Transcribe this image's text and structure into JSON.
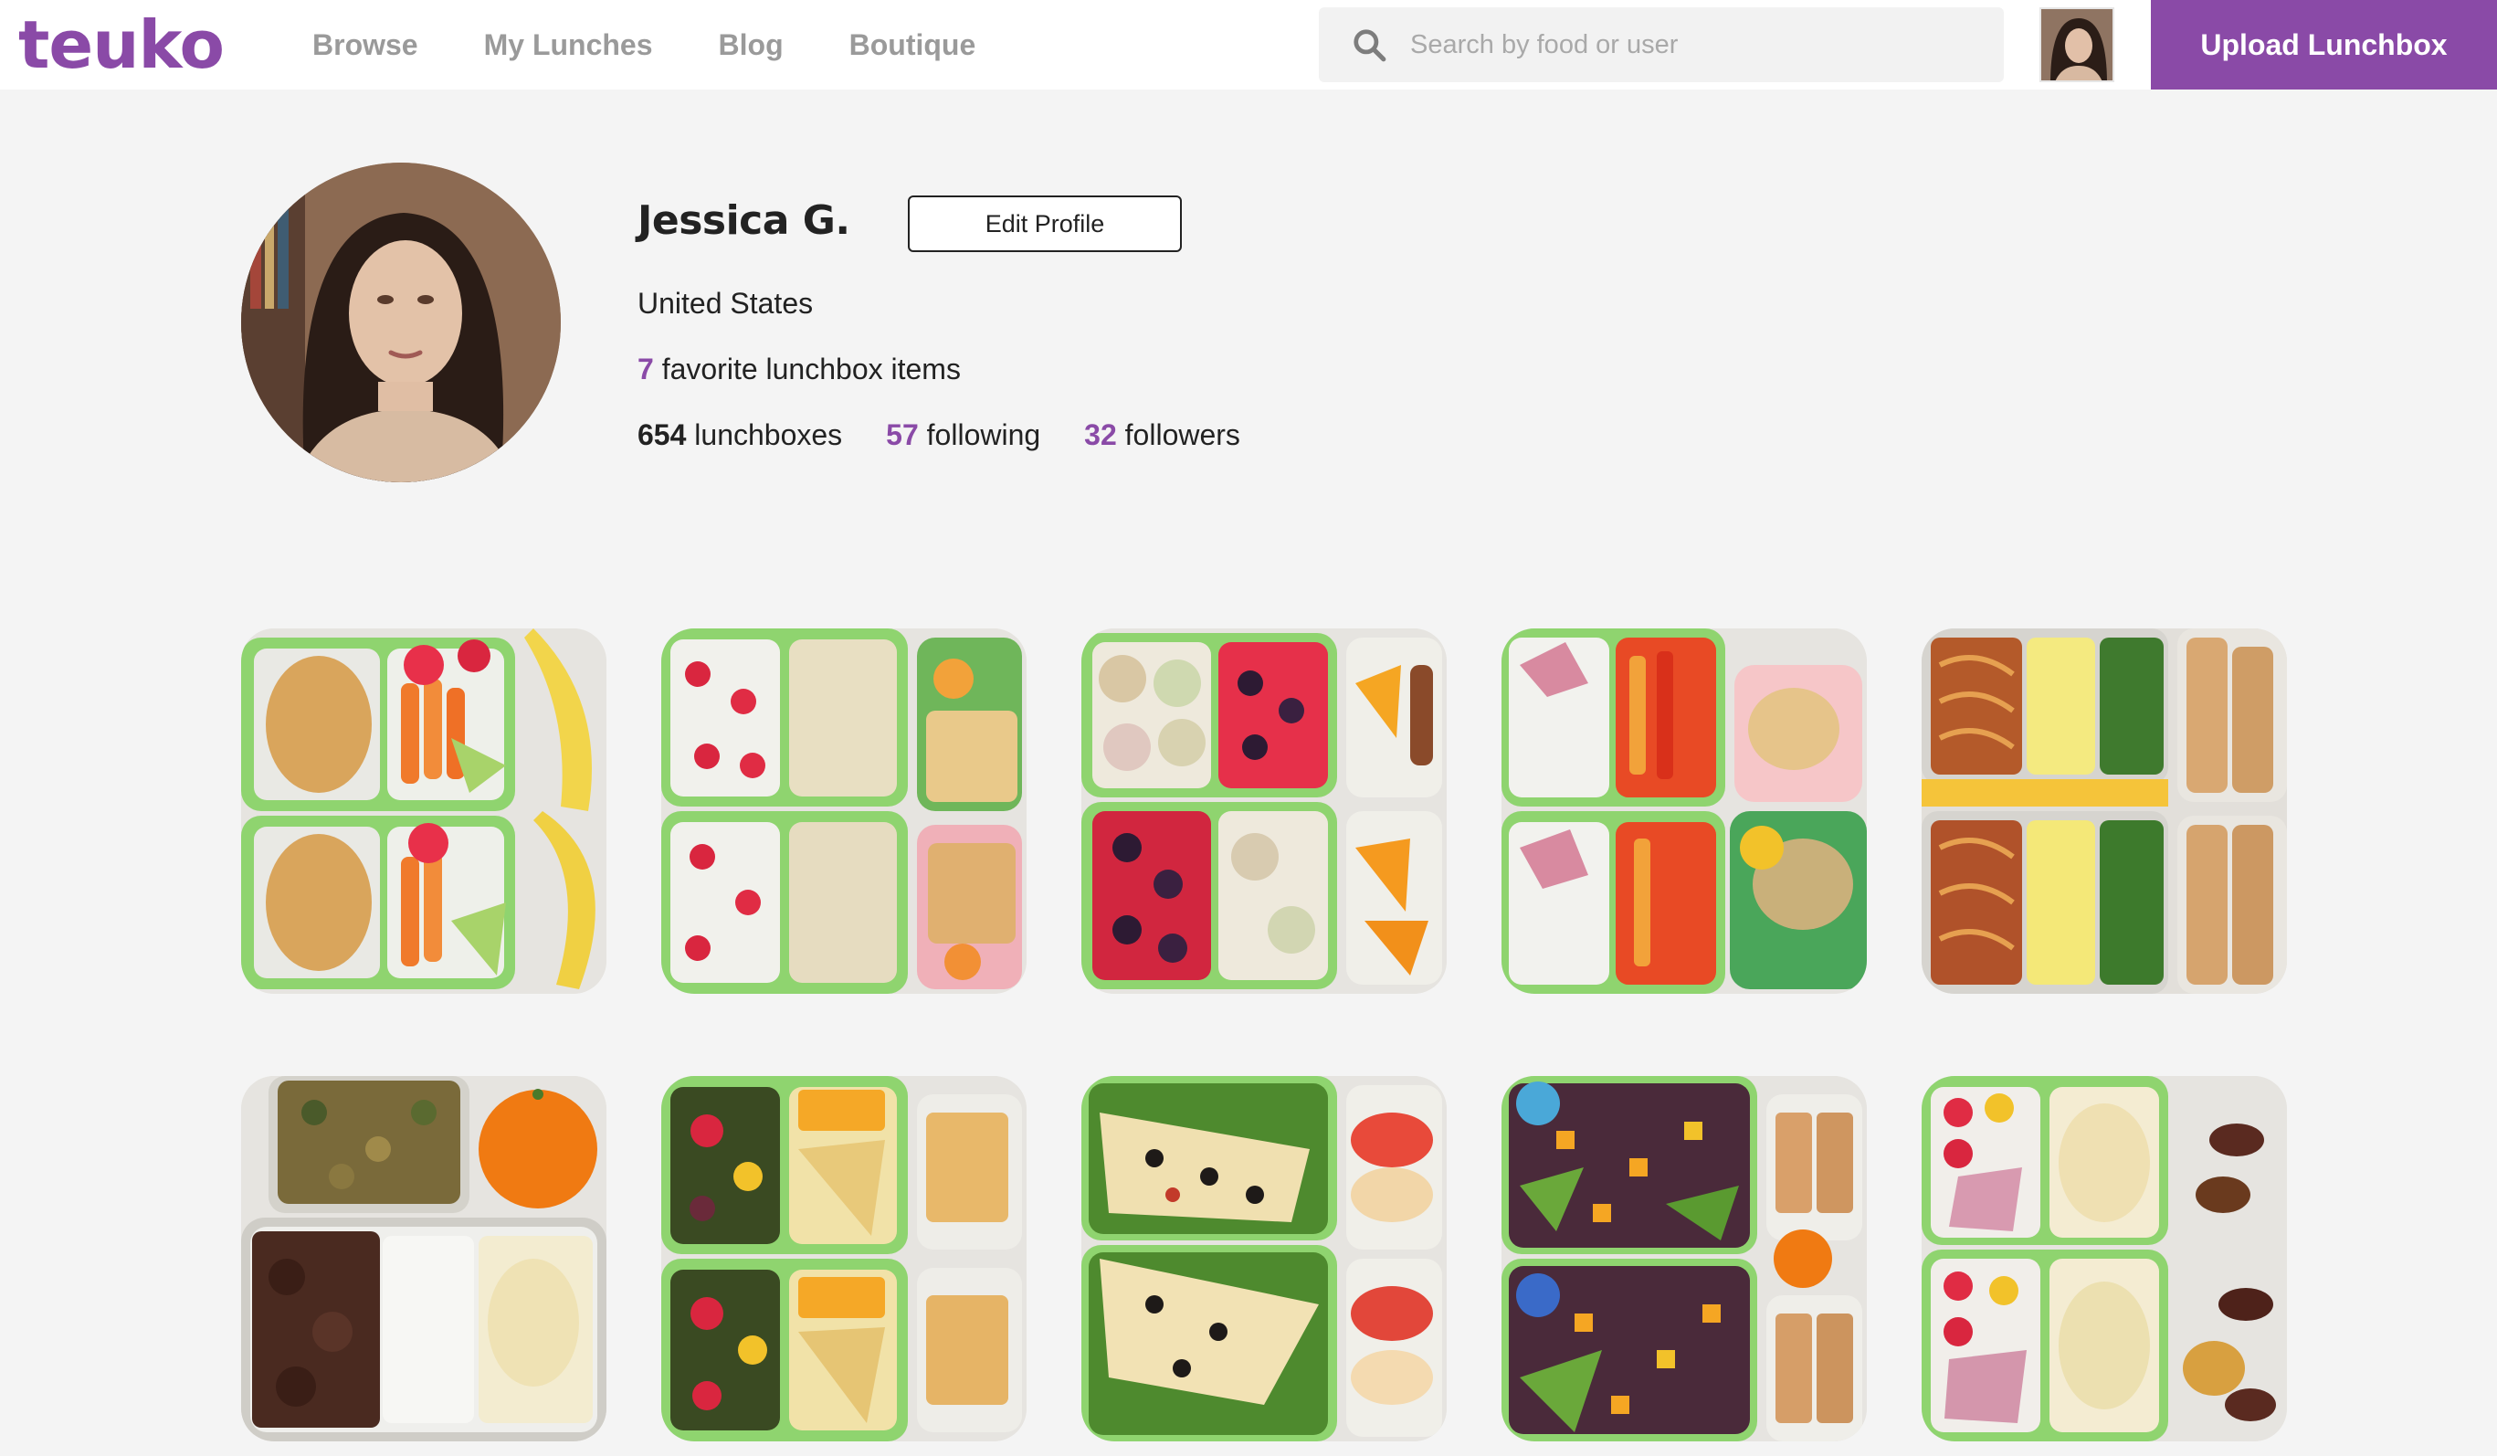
{
  "header": {
    "logo": "teuko",
    "nav": [
      "Browse",
      "My Lunches",
      "Blog",
      "Boutique"
    ],
    "search_placeholder": "Search by food or user",
    "upload_label": "Upload Lunchbox"
  },
  "profile": {
    "name": "Jessica G.",
    "edit_label": "Edit Profile",
    "country": "United States",
    "favorites_count": "7",
    "favorites_label": " favorite lunchbox items",
    "lunchboxes_count": "654",
    "lunchboxes_label": " lunchboxes",
    "following_count": "57",
    "following_label": " following",
    "followers_count": "32",
    "followers_label": " followers"
  },
  "colors": {
    "brand": "#8a4aa7",
    "box_green": "#8fd46f"
  }
}
